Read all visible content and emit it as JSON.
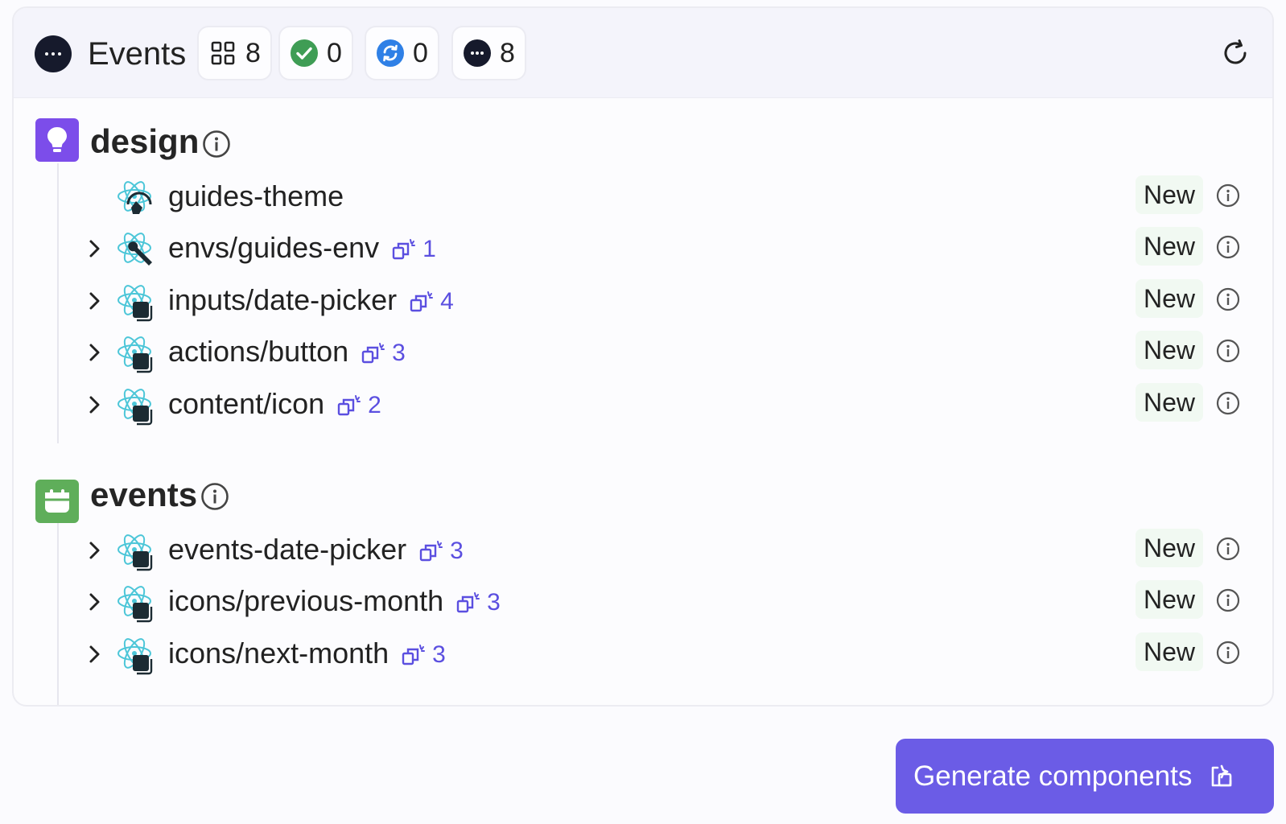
{
  "header": {
    "title": "Events",
    "counts": {
      "total": "8",
      "completed": "0",
      "in_progress": "0",
      "pending": "8"
    }
  },
  "sections": [
    {
      "name": "design",
      "icon": "lightbulb-icon",
      "color": "#7c4dea",
      "components": [
        {
          "name": "guides-theme",
          "icon": "react-theme-icon",
          "expandable": false,
          "deps": "",
          "status": "New"
        },
        {
          "name": "envs/guides-env",
          "icon": "react-env-icon",
          "expandable": true,
          "deps": "1",
          "status": "New"
        },
        {
          "name": "inputs/date-picker",
          "icon": "react-component-icon",
          "expandable": true,
          "deps": "4",
          "status": "New"
        },
        {
          "name": "actions/button",
          "icon": "react-component-icon",
          "expandable": true,
          "deps": "3",
          "status": "New"
        },
        {
          "name": "content/icon",
          "icon": "react-component-icon",
          "expandable": true,
          "deps": "2",
          "status": "New"
        }
      ]
    },
    {
      "name": "events",
      "icon": "calendar-icon",
      "color": "#5fae5a",
      "components": [
        {
          "name": "events-date-picker",
          "icon": "react-component-icon",
          "expandable": true,
          "deps": "3",
          "status": "New"
        },
        {
          "name": "icons/previous-month",
          "icon": "react-component-icon",
          "expandable": true,
          "deps": "3",
          "status": "New"
        },
        {
          "name": "icons/next-month",
          "icon": "react-component-icon",
          "expandable": true,
          "deps": "3",
          "status": "New"
        }
      ]
    }
  ],
  "actions": {
    "generate_label": "Generate components"
  },
  "colors": {
    "accent": "#6b5ce6",
    "success": "#3f9d55",
    "progress": "#2f80e6",
    "pending": "#161a2c"
  }
}
